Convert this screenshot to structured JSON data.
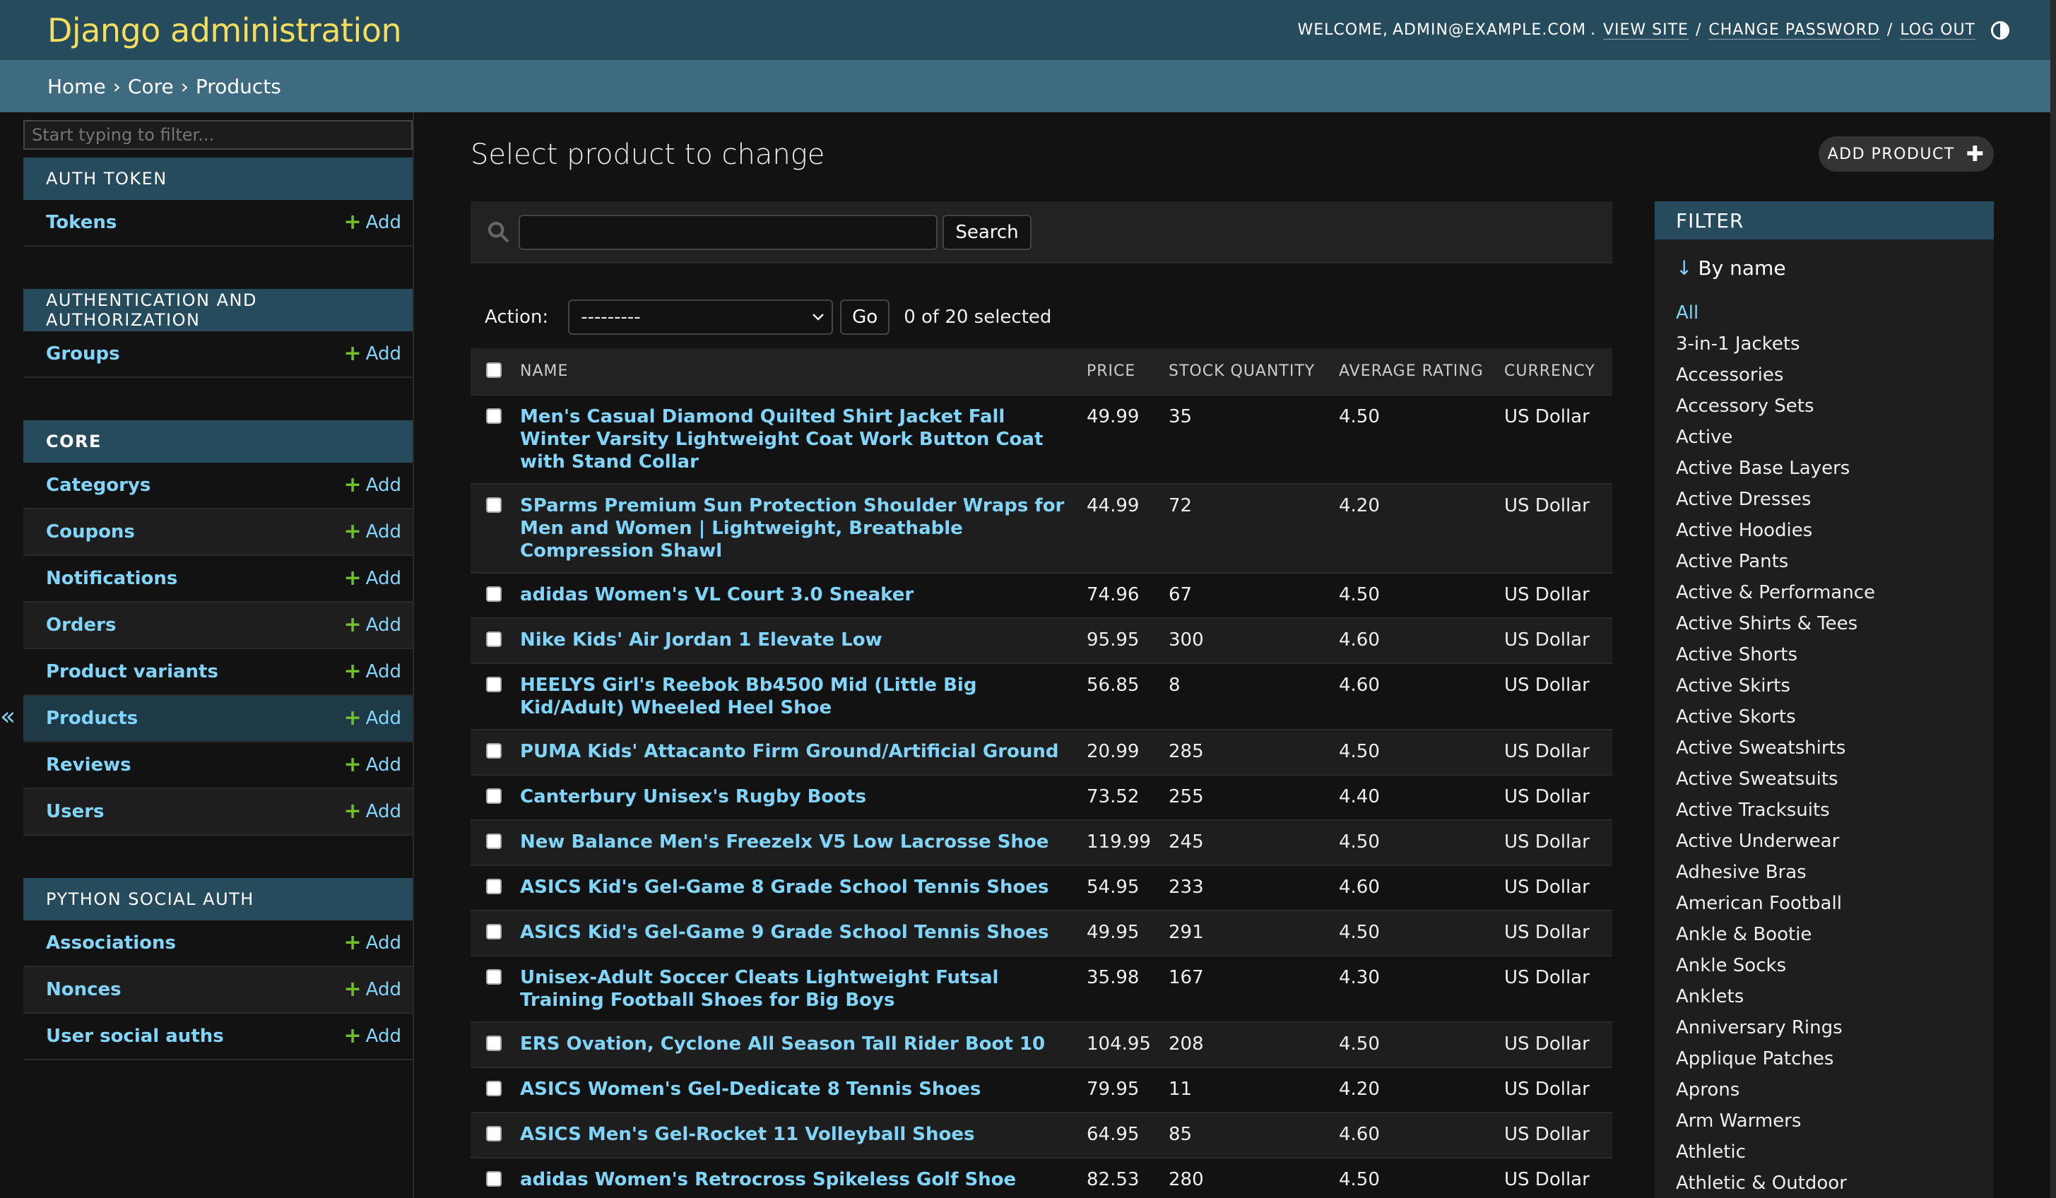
{
  "header": {
    "branding": "Django administration",
    "welcome": "WELCOME,",
    "user": "ADMIN@EXAMPLE.COM",
    "view_site": "VIEW SITE",
    "change_password": "CHANGE PASSWORD",
    "log_out": "LOG OUT"
  },
  "breadcrumbs": {
    "home": "Home",
    "app": "Core",
    "current": "Products"
  },
  "sidebar": {
    "filter_placeholder": "Start typing to filter...",
    "toggle": "«",
    "add_label": "Add",
    "apps": [
      {
        "caption": "AUTH TOKEN",
        "models": [
          "Tokens"
        ]
      },
      {
        "caption": "AUTHENTICATION AND AUTHORIZATION",
        "models": [
          "Groups"
        ]
      },
      {
        "caption": "CORE",
        "models": [
          "Categorys",
          "Coupons",
          "Notifications",
          "Orders",
          "Product variants",
          "Products",
          "Reviews",
          "Users"
        ]
      },
      {
        "caption": "PYTHON SOCIAL AUTH",
        "models": [
          "Associations",
          "Nonces",
          "User social auths"
        ]
      }
    ]
  },
  "content": {
    "title": "Select product to change",
    "add_button": "ADD PRODUCT",
    "search_button": "Search",
    "search_value": "",
    "action_label": "Action:",
    "action_selected": "---------",
    "go_button": "Go",
    "counter": "0 of 20 selected"
  },
  "table": {
    "columns": [
      "NAME",
      "PRICE",
      "STOCK QUANTITY",
      "AVERAGE RATING",
      "CURRENCY"
    ],
    "rows": [
      {
        "name": "Men's Casual Diamond Quilted Shirt Jacket Fall Winter Varsity Lightweight Coat Work Button Coat with Stand Collar",
        "price": "49.99",
        "stock": "35",
        "rating": "4.50",
        "currency": "US Dollar"
      },
      {
        "name": "SParms Premium Sun Protection Shoulder Wraps for Men and Women | Lightweight, Breathable Compression Shawl",
        "price": "44.99",
        "stock": "72",
        "rating": "4.20",
        "currency": "US Dollar"
      },
      {
        "name": "adidas Women's VL Court 3.0 Sneaker",
        "price": "74.96",
        "stock": "67",
        "rating": "4.50",
        "currency": "US Dollar"
      },
      {
        "name": "Nike Kids' Air Jordan 1 Elevate Low",
        "price": "95.95",
        "stock": "300",
        "rating": "4.60",
        "currency": "US Dollar"
      },
      {
        "name": "HEELYS Girl's Reebok Bb4500 Mid (Little Big Kid/Adult) Wheeled Heel Shoe",
        "price": "56.85",
        "stock": "8",
        "rating": "4.60",
        "currency": "US Dollar"
      },
      {
        "name": "PUMA Kids' Attacanto Firm Ground/Artificial Ground",
        "price": "20.99",
        "stock": "285",
        "rating": "4.50",
        "currency": "US Dollar"
      },
      {
        "name": "Canterbury Unisex's Rugby Boots",
        "price": "73.52",
        "stock": "255",
        "rating": "4.40",
        "currency": "US Dollar"
      },
      {
        "name": "New Balance Men's Freezelx V5 Low Lacrosse Shoe",
        "price": "119.99",
        "stock": "245",
        "rating": "4.50",
        "currency": "US Dollar"
      },
      {
        "name": "ASICS Kid's Gel-Game 8 Grade School Tennis Shoes",
        "price": "54.95",
        "stock": "233",
        "rating": "4.60",
        "currency": "US Dollar"
      },
      {
        "name": "ASICS Kid's Gel-Game 9 Grade School Tennis Shoes",
        "price": "49.95",
        "stock": "291",
        "rating": "4.50",
        "currency": "US Dollar"
      },
      {
        "name": "Unisex-Adult Soccer Cleats Lightweight Futsal Training Football Shoes for Big Boys",
        "price": "35.98",
        "stock": "167",
        "rating": "4.30",
        "currency": "US Dollar"
      },
      {
        "name": "ERS Ovation, Cyclone All Season Tall Rider Boot 10",
        "price": "104.95",
        "stock": "208",
        "rating": "4.50",
        "currency": "US Dollar"
      },
      {
        "name": "ASICS Women's Gel-Dedicate 8 Tennis Shoes",
        "price": "79.95",
        "stock": "11",
        "rating": "4.20",
        "currency": "US Dollar"
      },
      {
        "name": "ASICS Men's Gel-Rocket 11 Volleyball Shoes",
        "price": "64.95",
        "stock": "85",
        "rating": "4.60",
        "currency": "US Dollar"
      },
      {
        "name": "adidas Women's Retrocross Spikeless Golf Shoe",
        "price": "82.53",
        "stock": "280",
        "rating": "4.50",
        "currency": "US Dollar"
      }
    ]
  },
  "filter": {
    "title": "FILTER",
    "heading": "By name",
    "items": [
      "All",
      "3-in-1 Jackets",
      "Accessories",
      "Accessory Sets",
      "Active",
      "Active Base Layers",
      "Active Dresses",
      "Active Hoodies",
      "Active Pants",
      "Active & Performance",
      "Active Shirts & Tees",
      "Active Shorts",
      "Active Skirts",
      "Active Skorts",
      "Active Sweatshirts",
      "Active Sweatsuits",
      "Active Tracksuits",
      "Active Underwear",
      "Adhesive Bras",
      "American Football",
      "Ankle & Bootie",
      "Ankle Socks",
      "Anklets",
      "Anniversary Rings",
      "Applique Patches",
      "Aprons",
      "Arm Warmers",
      "Athletic",
      "Athletic & Outdoor"
    ]
  },
  "colors": {
    "header_bg": "#264b5d",
    "breadcrumbs_bg": "#3f6b80",
    "branding": "#f5dd5d",
    "link": "#81d4fa",
    "add_green": "#70bf2b",
    "page_bg": "#121212"
  }
}
